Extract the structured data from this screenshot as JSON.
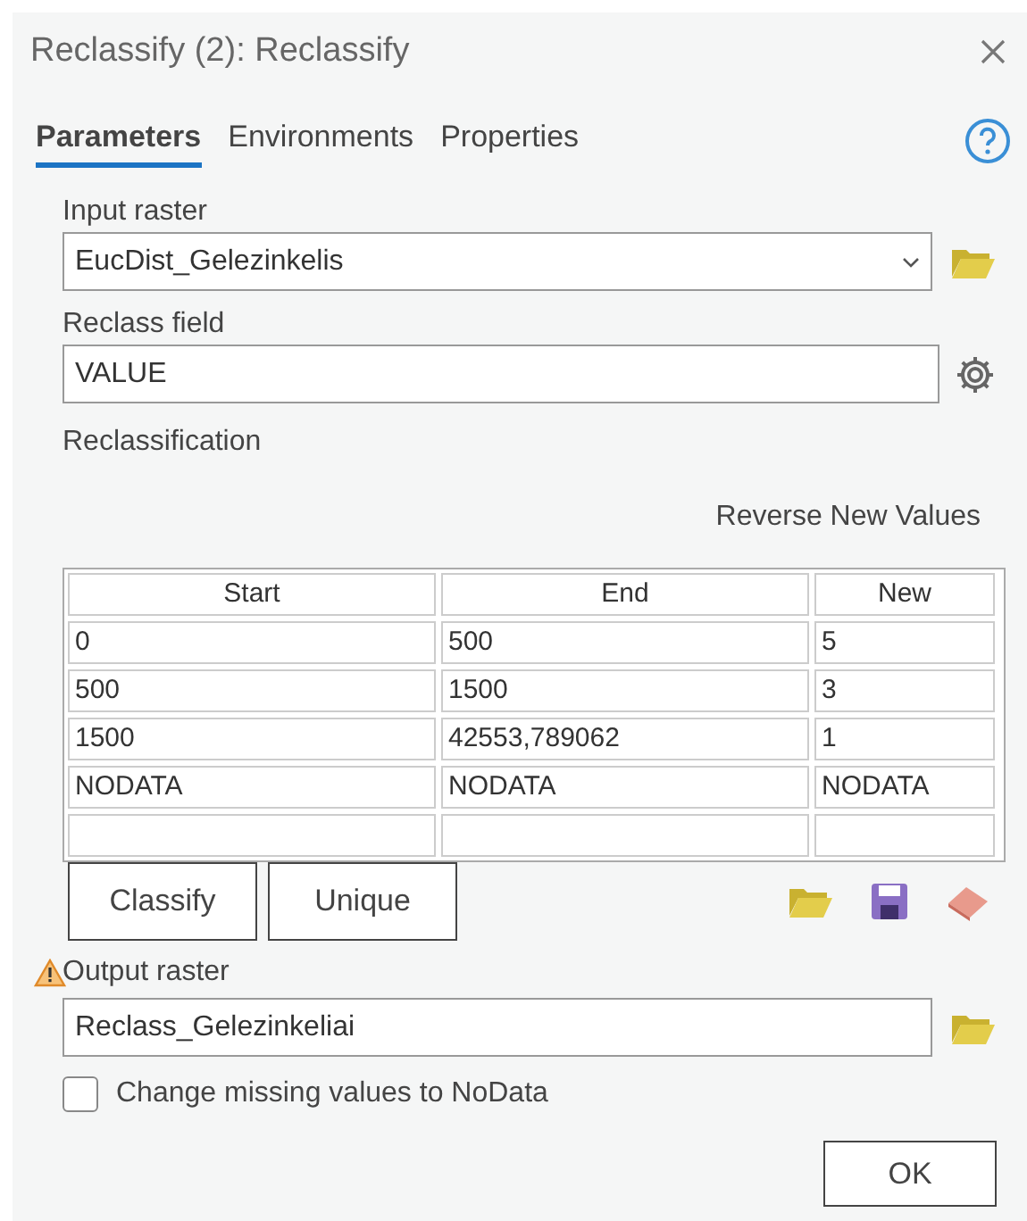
{
  "window": {
    "title": "Reclassify (2): Reclassify"
  },
  "tabs": [
    {
      "label": "Parameters",
      "selected": true
    },
    {
      "label": "Environments",
      "selected": false
    },
    {
      "label": "Properties",
      "selected": false
    }
  ],
  "input_raster": {
    "label": "Input raster",
    "value": "EucDist_Gelezinkelis"
  },
  "reclass_field": {
    "label": "Reclass field",
    "value": "VALUE"
  },
  "reclassification": {
    "label": "Reclassification",
    "reverse_link": "Reverse New Values",
    "columns": [
      "Start",
      "End",
      "New"
    ],
    "rows": [
      [
        "0",
        "500",
        "5"
      ],
      [
        "500",
        "1500",
        "3"
      ],
      [
        "1500",
        "42553,789062",
        "1"
      ],
      [
        "NODATA",
        "NODATA",
        "NODATA"
      ],
      [
        "",
        "",
        ""
      ]
    ],
    "buttons": [
      "Classify",
      "Unique"
    ]
  },
  "output_raster": {
    "label": "Output raster",
    "value": "Reclass_Gelezinkeliai",
    "warning": true
  },
  "change_missing": {
    "label": "Change missing values to NoData",
    "checked": false
  },
  "buttons": [
    "OK"
  ]
}
